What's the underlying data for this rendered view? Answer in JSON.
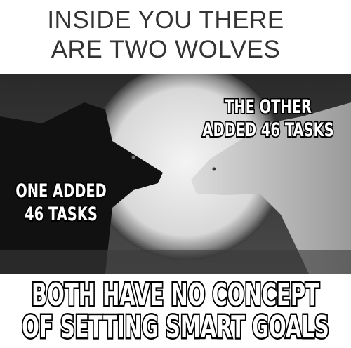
{
  "top_caption": {
    "line1": "INSIDE YOU THERE",
    "line2": "ARE TWO WOLVES"
  },
  "labels": {
    "other_line1": "THE OTHER",
    "other_line2": "ADDED 46 TASKS",
    "one_line1": "ONE ADDED",
    "one_line2": "46 TASKS"
  },
  "bottom_caption": {
    "line1": "BOTH HAVE NO CONCEPT",
    "line2": "OF SETTING SMART GOALS"
  }
}
